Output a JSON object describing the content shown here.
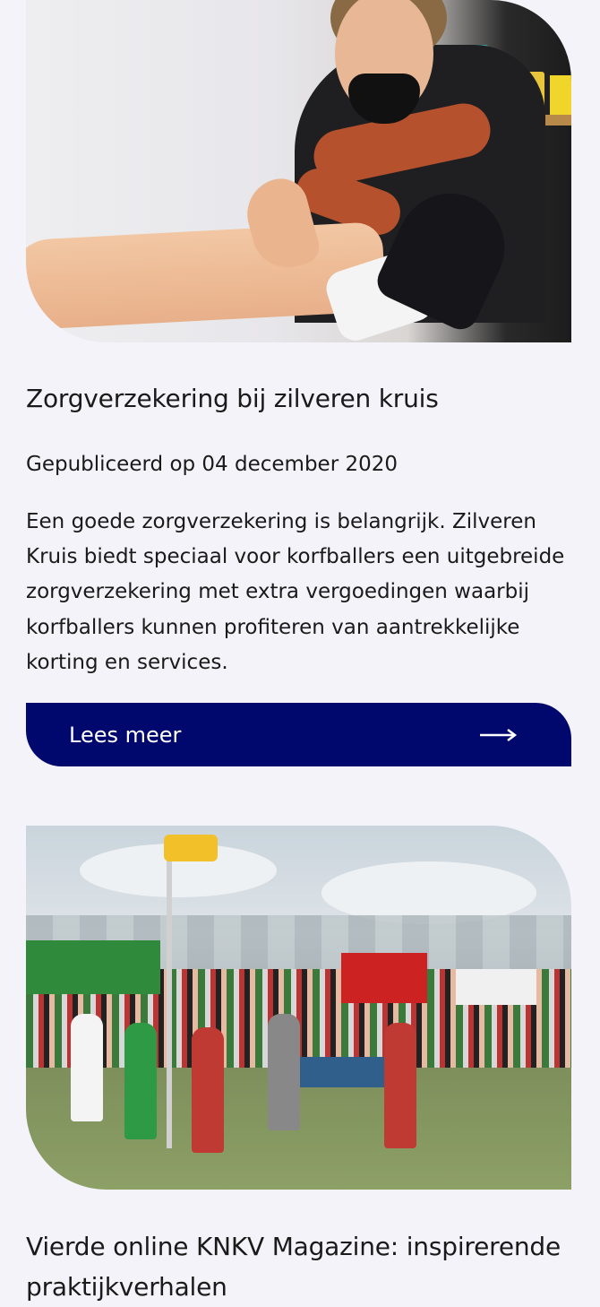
{
  "articles": [
    {
      "image_alt": "Fysiotherapeut behandelt voet van korfballer",
      "title": "Zorgverzekering bij zilveren kruis",
      "published": "Gepubliceerd op 04 december 2020",
      "body": "Een goede zorgverzekering is belangrijk. Zilveren Kruis biedt speciaal voor korfballers een uitgebreide zorgverzekering met extra vergoedingen waarbij korfballers kunnen profiteren van aantrekkelijke korting en services.",
      "button_label": "Lees meer",
      "button_icon": "arrow-right-icon"
    },
    {
      "image_alt": "Korfbalwedstrijd op veld met publiek",
      "title": "Vierde online KNKV Magazine: inspirerende praktijkverhalen"
    }
  ],
  "colors": {
    "background": "#f4f3fa",
    "button": "#00086e",
    "text": "#1a1a1a"
  }
}
